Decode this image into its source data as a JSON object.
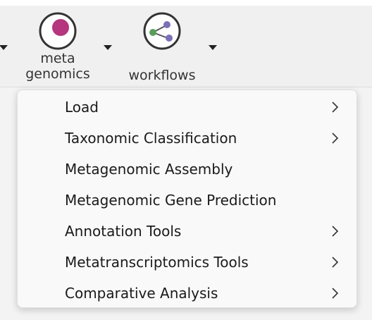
{
  "toolbar": {
    "buttons": [
      {
        "label_line1": "meta",
        "label_line2": "genomics",
        "icon": "metagenomics-icon",
        "accent": "#b5357e"
      },
      {
        "label": "workflows",
        "icon": "workflows-icon",
        "accent_nodes": [
          "#5a9e5a",
          "#7b6fb8",
          "#7b6fb8"
        ]
      }
    ]
  },
  "menu": {
    "items": [
      {
        "label": "Load",
        "submenu": true
      },
      {
        "label": "Taxonomic Classification",
        "submenu": true
      },
      {
        "label": "Metagenomic Assembly",
        "submenu": false
      },
      {
        "label": "Metagenomic Gene Prediction",
        "submenu": false
      },
      {
        "label": "Annotation Tools",
        "submenu": true
      },
      {
        "label": "Metatranscriptomics Tools",
        "submenu": true
      },
      {
        "label": "Comparative Analysis",
        "submenu": true
      }
    ]
  }
}
